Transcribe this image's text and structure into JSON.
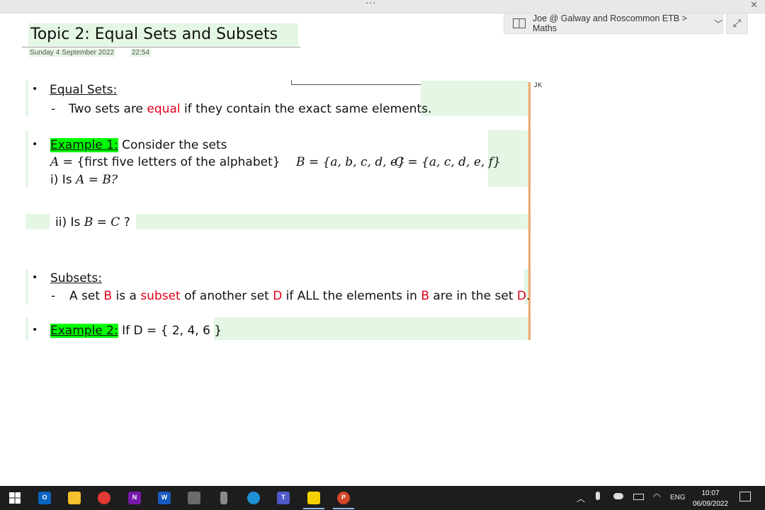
{
  "window": {
    "dots": "···",
    "close_label": "✕"
  },
  "breadcrumb": {
    "text": "Joe @ Galway and Roscommon ETB > Maths",
    "chevron": "﹀"
  },
  "expand": {
    "glyph": "⤢"
  },
  "page": {
    "title": "Topic 2: Equal Sets and Subsets",
    "date": "Sunday 4 September 2022",
    "time": "22:54",
    "author": "JK"
  },
  "notes": {
    "bullet": "•",
    "dash": "-",
    "equal_sets": {
      "heading": "Equal Sets:",
      "p1": "Two sets are ",
      "kw": "equal",
      "p2": " if they contain the exact same elements."
    },
    "example1": {
      "label": "Example 1:",
      "text": " Consider the sets",
      "set_a_name": "A",
      "set_a_eq": " = {",
      "set_a_desc": "first five letters of the alphabet",
      "set_a_close": "}",
      "set_b": "B = {a, b, c, d, e}",
      "set_c": "C = {a, c,  d, e, f}",
      "q1_prefix": "i) Is ",
      "q1_math": "A = B?",
      "q2_prefix": "ii) Is ",
      "q2_math": "B = C",
      "q2_suffix": " ?"
    },
    "subsets": {
      "heading": "Subsets:",
      "p1": "A set ",
      "b1": "B",
      "p2": " is a ",
      "kw": "subset",
      "p3": " of another set ",
      "d1": "D",
      "p4": " if ALL the elements in ",
      "b2": "B",
      "p5": " are in the set ",
      "d2": "D",
      "p6": "."
    },
    "example2": {
      "label": "Example 2:",
      "text": " If D = { 2, 4, 6 }"
    }
  },
  "taskbar": {
    "icons": [
      {
        "name": "windows-start-icon",
        "color": "#ffffff",
        "label": ""
      },
      {
        "name": "outlook-icon",
        "color": "#0a64c2",
        "label": "O"
      },
      {
        "name": "file-explorer-icon",
        "color": "#f3c12b",
        "label": ""
      },
      {
        "name": "chrome-icon",
        "color": "#e53935",
        "label": ""
      },
      {
        "name": "onenote-icon",
        "color": "#7719aa",
        "label": "N"
      },
      {
        "name": "word-icon",
        "color": "#185abd",
        "label": "W"
      },
      {
        "name": "calculator-icon",
        "color": "#6b6b6b",
        "label": ""
      },
      {
        "name": "phone-icon",
        "color": "#8a8a8a",
        "label": ""
      },
      {
        "name": "snipping-icon",
        "color": "#1f8fd6",
        "label": ""
      },
      {
        "name": "teams-icon",
        "color": "#5059c9",
        "label": "T"
      },
      {
        "name": "sticky-notes-icon",
        "color": "#f5d000",
        "label": ""
      },
      {
        "name": "powerpoint-icon",
        "color": "#d24726",
        "label": "P"
      }
    ],
    "lang": "ENG",
    "clock_time": "10:07",
    "clock_date": "06/09/2022"
  }
}
